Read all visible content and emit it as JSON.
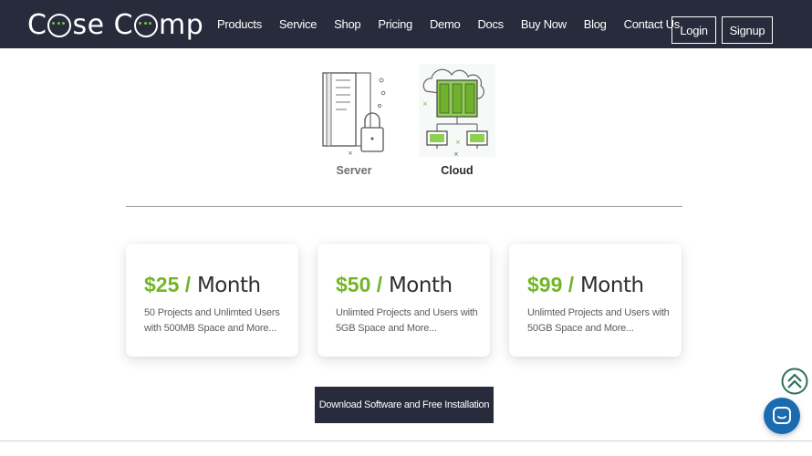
{
  "header": {
    "logo_text": "CaseComp",
    "nav_items": [
      "Products",
      "Service",
      "Shop",
      "Pricing",
      "Demo",
      "Docs",
      "Buy Now",
      "Blog",
      "Contact Us"
    ],
    "login_label": "Login",
    "signup_label": "Signup"
  },
  "deploy_options": [
    {
      "label": "Server",
      "icon": "server-lock-icon"
    },
    {
      "label": "Cloud",
      "icon": "cloud-network-icon"
    }
  ],
  "pricing": [
    {
      "amount": "$25 /",
      "period": " Month",
      "description": "50 Projects and Unlimted Users with 500MB Space and More..."
    },
    {
      "amount": "$50 /",
      "period": " Month",
      "description": "Unlimted Projects and Users with 5GB Space and More..."
    },
    {
      "amount": "$99 /",
      "period": " Month",
      "description": "Unlimted Projects and Users with 50GB Space and More..."
    }
  ],
  "download_button_label": "Download Software and Free Installation",
  "floating": {
    "scroll_top_icon": "double-chevron-up-icon",
    "chat_icon": "chat-icon"
  },
  "colors": {
    "navbar": "#272b3c",
    "accent_green": "#72b626",
    "chat_blue": "#1a6bb0"
  }
}
